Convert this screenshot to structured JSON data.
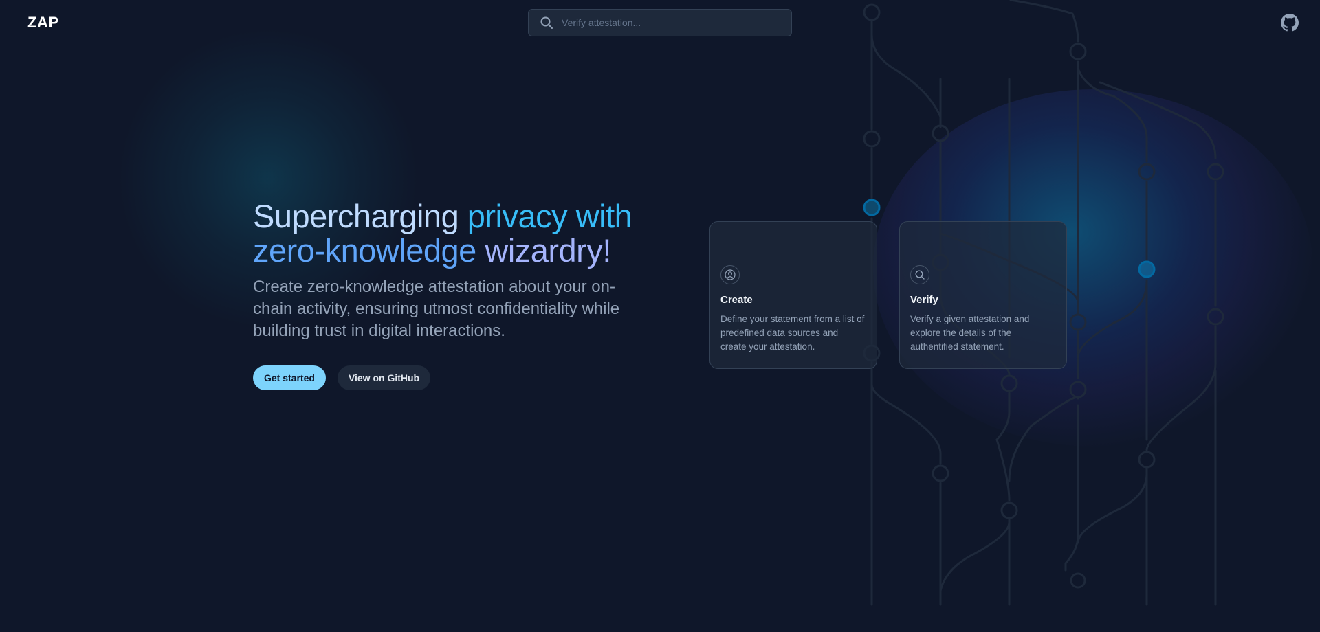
{
  "header": {
    "logo": "ZAP",
    "search_placeholder": "Verify attestation...",
    "search_icon": "search-icon",
    "github_icon": "github-icon"
  },
  "hero": {
    "title_part1": "Supercharging ",
    "title_part2": "privacy with",
    "title_part3": "zero-knowledge",
    "title_part4": " wizardry!",
    "subtitle": "Create zero-knowledge attestation about your on-chain activity, ensuring utmost confidentiality while building trust in digital interactions.",
    "primary_button": "Get started",
    "secondary_button": "View on GitHub"
  },
  "cards": [
    {
      "icon": "user-icon",
      "title": "Create",
      "description": "Define your statement from a list of predefined data sources and create your attestation."
    },
    {
      "icon": "search-icon",
      "title": "Verify",
      "description": "Verify a given attestation and explore the details of the authentified statement."
    }
  ],
  "colors": {
    "background": "#0f172a",
    "primary_button": "#7dd3fc",
    "accent": "#38bdf8"
  }
}
